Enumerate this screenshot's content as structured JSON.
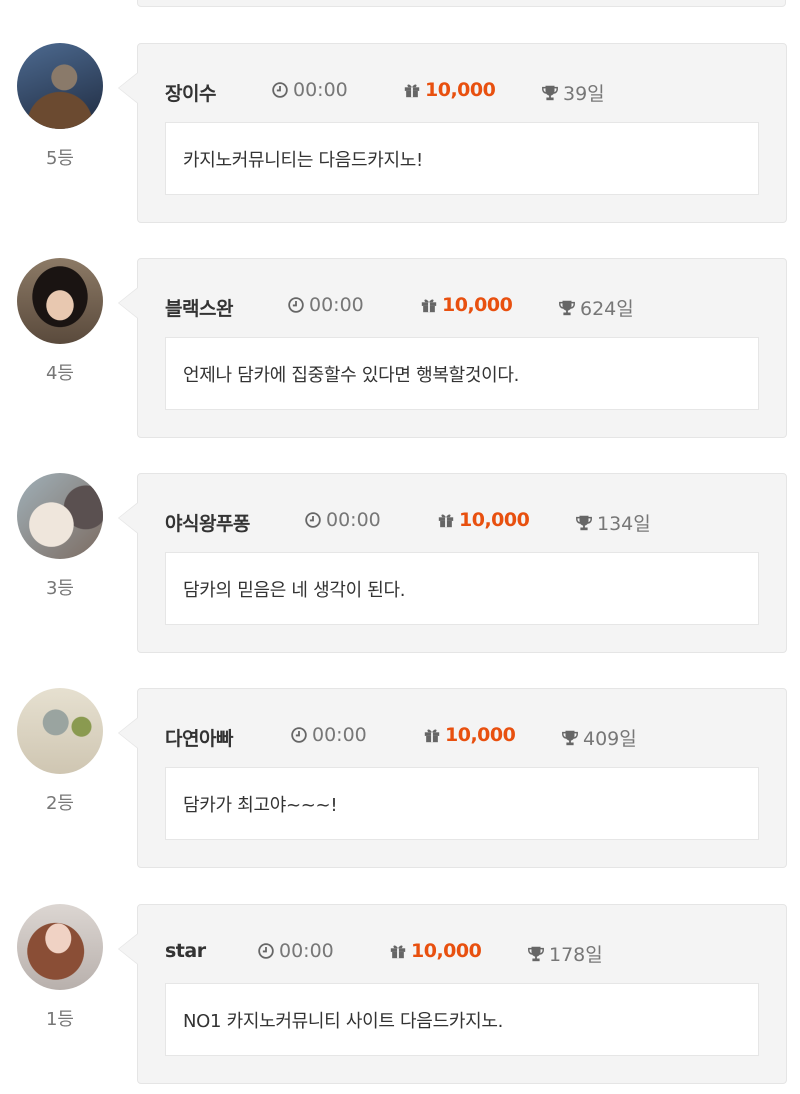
{
  "entries": [
    {
      "rank": "5등",
      "name": "장이수",
      "time": "00:00",
      "gift": "10,000",
      "days": "39일",
      "message": "카지노커뮤니티는 다음드카지노!",
      "avatar_color": "#2c3e57"
    },
    {
      "rank": "4등",
      "name": "블랙스완",
      "time": "00:00",
      "gift": "10,000",
      "days": "624일",
      "message": "언제나 담카에 집중할수 있다면 행복할것이다.",
      "avatar_color": "#6b5a4e"
    },
    {
      "rank": "3등",
      "name": "야식왕푸퐁",
      "time": "00:00",
      "gift": "10,000",
      "days": "134일",
      "message": "담카의 믿음은 네 생각이 된다.",
      "avatar_color": "#b8a898"
    },
    {
      "rank": "2등",
      "name": "다연아빠",
      "time": "00:00",
      "gift": "10,000",
      "days": "409일",
      "message": "담카가 최고야~~~!",
      "avatar_color": "#d8d2c0"
    },
    {
      "rank": "1등",
      "name": "star",
      "time": "00:00",
      "gift": "10,000",
      "days": "178일",
      "message": "NO1 카지노커뮤니티 사이트 다음드카지노.",
      "avatar_color": "#b07a62"
    }
  ],
  "colors": {
    "accent": "#e8500f",
    "card_bg": "#f4f4f4",
    "muted": "#777777"
  },
  "icons": {
    "time": "clock-icon",
    "gift": "gift-icon",
    "days": "trophy-icon"
  }
}
